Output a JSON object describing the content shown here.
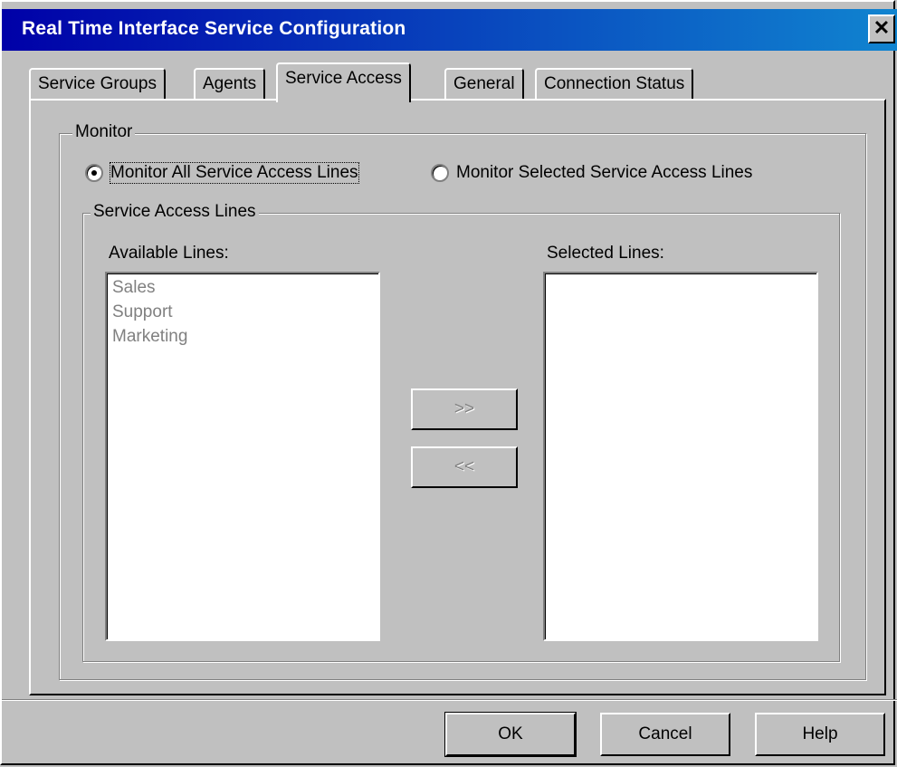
{
  "window": {
    "title": "Real Time Interface Service Configuration",
    "close_label": "✕"
  },
  "tabs": [
    {
      "label": "Service Groups",
      "active": false
    },
    {
      "label": "Agents",
      "active": false
    },
    {
      "label": "Service Access",
      "active": true
    },
    {
      "label": "General",
      "active": false
    },
    {
      "label": "Connection Status",
      "active": false
    }
  ],
  "monitor": {
    "group_label": "Monitor",
    "option_all": "Monitor All Service Access Lines",
    "option_selected": "Monitor Selected Service Access Lines",
    "selected_option": "all"
  },
  "lines": {
    "group_label": "Service Access Lines",
    "available_label": "Available Lines:",
    "selected_label": "Selected Lines:",
    "available_items": [
      "Sales",
      "Support",
      "Marketing"
    ],
    "selected_items": [],
    "add_label": ">>",
    "remove_label": "<<"
  },
  "buttons": {
    "ok": "OK",
    "cancel": "Cancel",
    "help": "Help"
  },
  "colors": {
    "face": "#c0c0c0",
    "title_start": "#0000a8",
    "title_end": "#1084d0",
    "disabled_text": "#808080"
  }
}
